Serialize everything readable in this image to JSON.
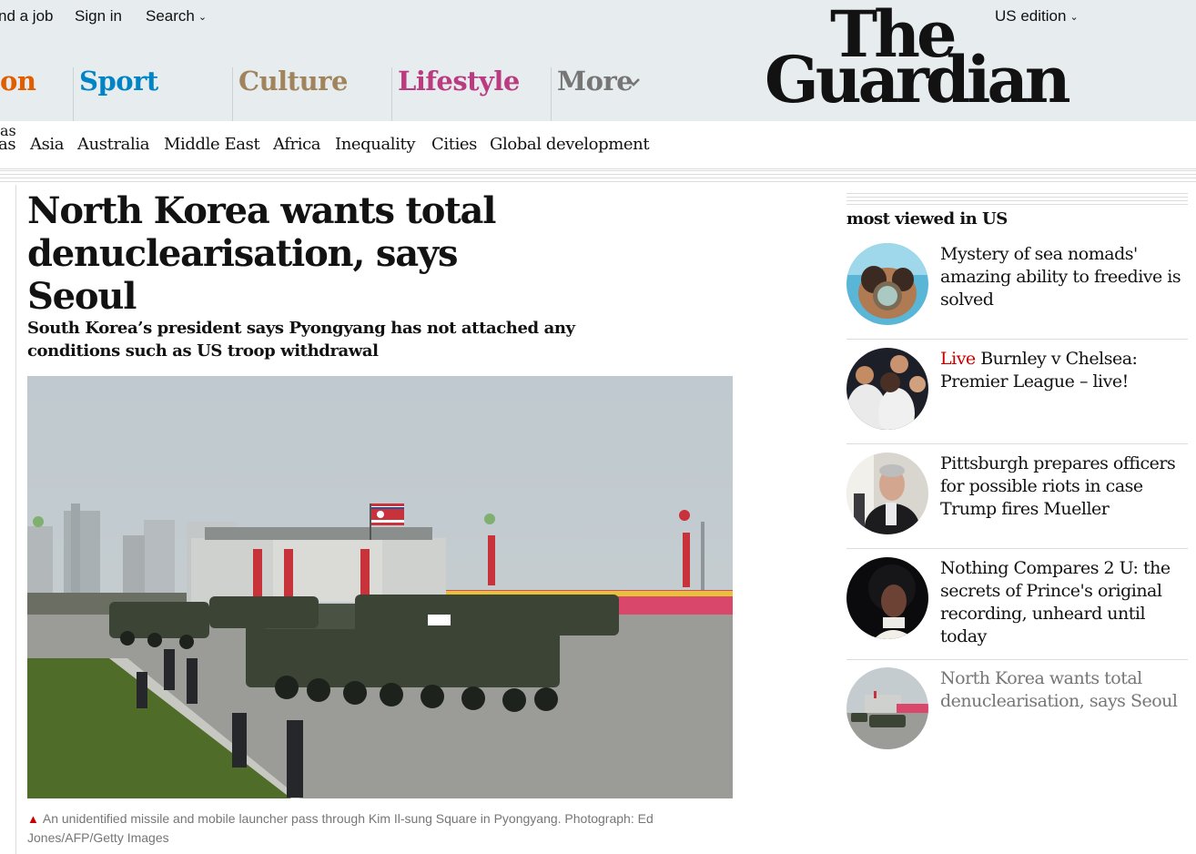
{
  "header": {
    "utility": {
      "find_job": "nd a job",
      "sign_in": "Sign in",
      "search": "Search",
      "edition": "US edition"
    },
    "pillars": [
      {
        "label": "on",
        "color": "#e05e00"
      },
      {
        "label": "Sport",
        "color": "#0084c6"
      },
      {
        "label": "Culture",
        "color": "#a1845c"
      },
      {
        "label": "Lifestyle",
        "color": "#bb3b80"
      },
      {
        "label": "More",
        "color": "#767676"
      }
    ],
    "logo": {
      "line1": "The",
      "line2": "Guardian"
    }
  },
  "subnav": [
    "as",
    "Asia",
    "Australia",
    "Middle East",
    "Africa",
    "Inequality",
    "Cities",
    "Global development"
  ],
  "article": {
    "headline_line1": "North Korea wants total",
    "headline_line2": "denuclearisation, says Seoul",
    "standfirst_line1": "South Korea’s president says Pyongyang has not attached any",
    "standfirst_line2": "conditions such as US troop withdrawal",
    "caption": "An unidentified missile and mobile launcher pass through Kim Il-sung Square in Pyongyang. Photograph: Ed Jones/AFP/Getty Images"
  },
  "most_viewed": {
    "title": "most viewed in US",
    "items": [
      {
        "kicker": "",
        "text": "Mystery of sea nomads' amazing ability to freedive is solved",
        "color": "#121212"
      },
      {
        "kicker": "Live",
        "text": "Burnley v Chelsea: Premier League – live!",
        "color": "#121212"
      },
      {
        "kicker": "",
        "text": "Pittsburgh prepares officers for possible riots in case Trump fires Mueller",
        "color": "#121212"
      },
      {
        "kicker": "",
        "text": "Nothing Compares 2 U: the secrets of Prince's original recording, unheard until today",
        "color": "#121212"
      },
      {
        "kicker": "",
        "text": "North Korea wants total denuclearisation, says Seoul",
        "color": "#767676"
      }
    ]
  }
}
